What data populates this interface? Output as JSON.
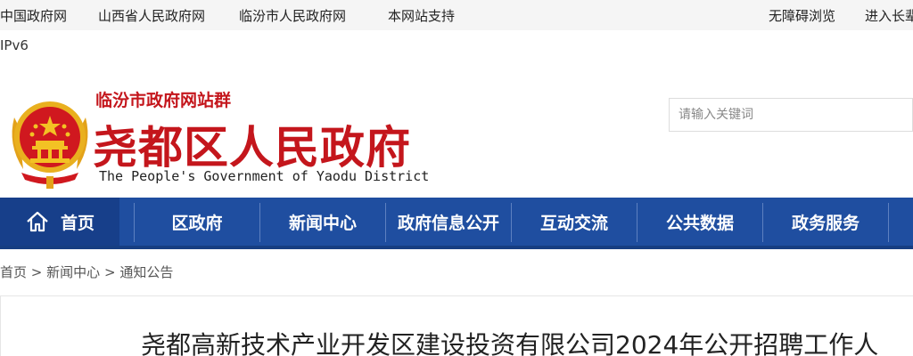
{
  "topbar": {
    "links": [
      "中国政府网",
      "山西省人民政府网",
      "临汾市人民政府网",
      "本网站支持"
    ],
    "accessibility": "无障碍浏览",
    "elder_mode": "进入长辈",
    "ipv6": "IPv6"
  },
  "header": {
    "site_group": "临汾市政府网站群",
    "title": "尧都区人民政府",
    "title_en": "The People's Government of Yaodu District",
    "emblem_icon": "national-emblem-icon"
  },
  "search": {
    "placeholder": "请输入关键词"
  },
  "nav": {
    "items": [
      "首页",
      "区政府",
      "新闻中心",
      "政府信息公开",
      "互动交流",
      "公共数据",
      "政务服务"
    ]
  },
  "breadcrumb": {
    "items": [
      "首页",
      "新闻中心",
      "通知公告"
    ],
    "separator": ">"
  },
  "article": {
    "title": "尧都高新技术产业开发区建设投资有限公司2024年公开招聘工作人"
  },
  "colors": {
    "brand_red": "#c4161c",
    "nav_blue": "#1f4ea0",
    "nav_home": "#173f8a"
  }
}
